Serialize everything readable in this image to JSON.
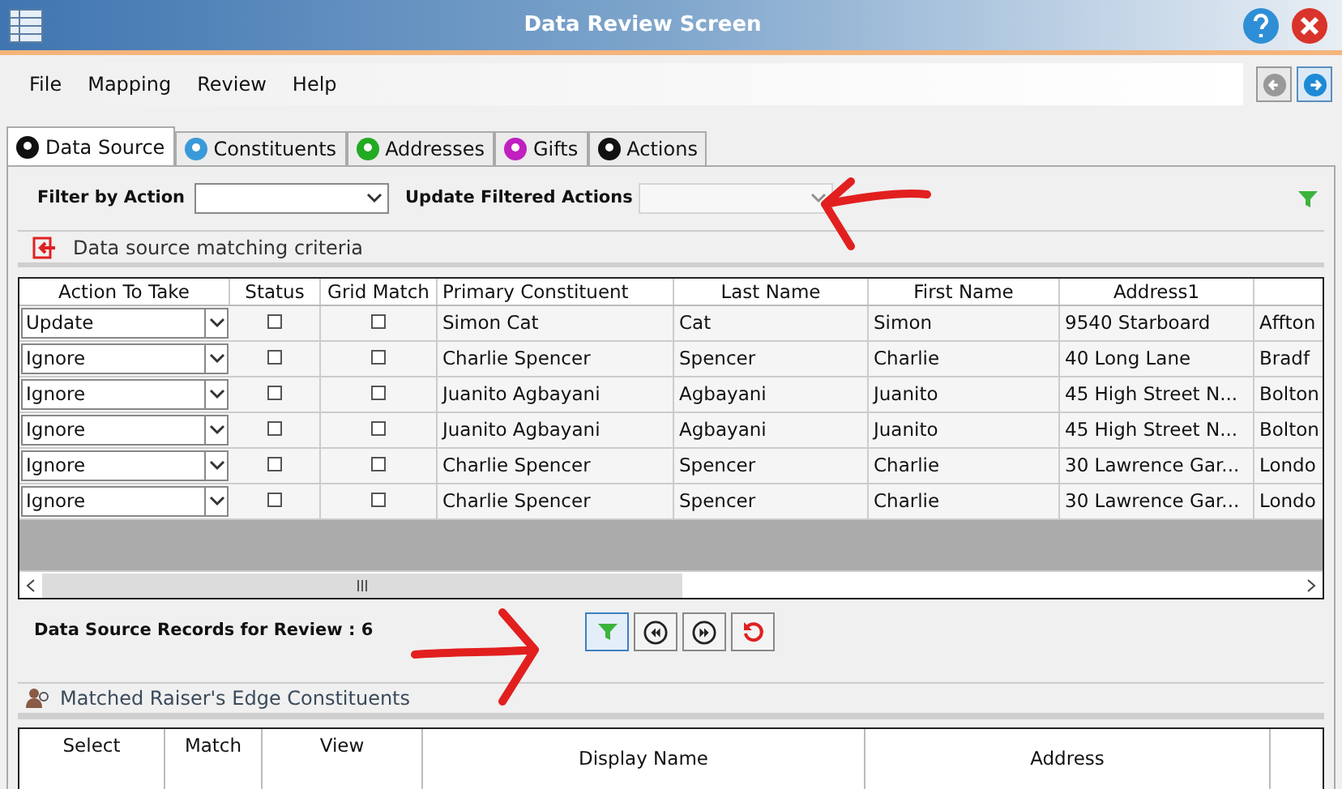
{
  "window": {
    "title": "Data Review Screen"
  },
  "menu": [
    "File",
    "Mapping",
    "Review",
    "Help"
  ],
  "tabs": [
    {
      "label": "Data Source",
      "selected": true,
      "color": "#111111"
    },
    {
      "label": "Constituents",
      "selected": false,
      "color": "#3a9ad9"
    },
    {
      "label": "Addresses",
      "selected": false,
      "color": "#22aa22"
    },
    {
      "label": "Gifts",
      "selected": false,
      "color": "#c020c0"
    },
    {
      "label": "Actions",
      "selected": false,
      "color": "#111111"
    }
  ],
  "filters": {
    "filter_label": "Filter by Action",
    "update_label": "Update Filtered Actions",
    "update_disabled": true
  },
  "criteria_label": "Data source matching criteria",
  "grid": {
    "columns": [
      "Action To Take",
      "Status",
      "Grid Match",
      "Primary Constituent",
      "Last Name",
      "First Name",
      "Address1"
    ],
    "rows": [
      {
        "cells": [
          {
            "kind": "dropdown",
            "text": "Update"
          },
          {
            "kind": "checkbox",
            "checked": false
          },
          {
            "kind": "checkbox",
            "checked": false
          },
          {
            "kind": "text",
            "text": "Simon Cat"
          },
          {
            "kind": "text",
            "text": "Cat"
          },
          {
            "kind": "text",
            "text": "Simon"
          },
          {
            "kind": "text",
            "text": "9540 Starboard"
          },
          {
            "kind": "text",
            "text": "Affton"
          }
        ]
      },
      {
        "cells": [
          {
            "kind": "dropdown",
            "text": "Ignore"
          },
          {
            "kind": "checkbox",
            "checked": false
          },
          {
            "kind": "checkbox",
            "checked": false
          },
          {
            "kind": "text",
            "text": "Charlie Spencer"
          },
          {
            "kind": "text",
            "text": "Spencer"
          },
          {
            "kind": "text",
            "text": "Charlie"
          },
          {
            "kind": "text",
            "text": "40 Long Lane"
          },
          {
            "kind": "text",
            "text": "Bradf"
          }
        ]
      },
      {
        "cells": [
          {
            "kind": "dropdown",
            "text": "Ignore"
          },
          {
            "kind": "checkbox",
            "checked": false
          },
          {
            "kind": "checkbox",
            "checked": false
          },
          {
            "kind": "text",
            "text": "Juanito Agbayani"
          },
          {
            "kind": "text",
            "text": "Agbayani"
          },
          {
            "kind": "text",
            "text": "Juanito"
          },
          {
            "kind": "text",
            "text": "45 High Street N..."
          },
          {
            "kind": "text",
            "text": "Bolton"
          }
        ]
      },
      {
        "cells": [
          {
            "kind": "dropdown",
            "text": "Ignore"
          },
          {
            "kind": "checkbox",
            "checked": false
          },
          {
            "kind": "checkbox",
            "checked": false
          },
          {
            "kind": "text",
            "text": "Juanito Agbayani"
          },
          {
            "kind": "text",
            "text": "Agbayani"
          },
          {
            "kind": "text",
            "text": "Juanito"
          },
          {
            "kind": "text",
            "text": "45 High Street N..."
          },
          {
            "kind": "text",
            "text": "Bolton"
          }
        ]
      },
      {
        "cells": [
          {
            "kind": "dropdown",
            "text": "Ignore"
          },
          {
            "kind": "checkbox",
            "checked": false
          },
          {
            "kind": "checkbox",
            "checked": false
          },
          {
            "kind": "text",
            "text": "Charlie Spencer"
          },
          {
            "kind": "text",
            "text": "Spencer"
          },
          {
            "kind": "text",
            "text": "Charlie"
          },
          {
            "kind": "text",
            "text": "30 Lawrence Gar..."
          },
          {
            "kind": "text",
            "text": "Londo"
          }
        ]
      },
      {
        "cells": [
          {
            "kind": "dropdown",
            "text": "Ignore"
          },
          {
            "kind": "checkbox",
            "checked": false
          },
          {
            "kind": "checkbox",
            "checked": false
          },
          {
            "kind": "text",
            "text": "Charlie Spencer"
          },
          {
            "kind": "text",
            "text": "Spencer"
          },
          {
            "kind": "text",
            "text": "Charlie"
          },
          {
            "kind": "text",
            "text": "30 Lawrence Gar..."
          },
          {
            "kind": "text",
            "text": "Londo"
          }
        ]
      }
    ]
  },
  "records_label": "Data Source Records for Review : 6",
  "matched_label": "Matched Raiser's Edge Constituents",
  "matched_grid": {
    "columns": [
      "Select",
      "Match",
      "View",
      "Display Name",
      "Address"
    ]
  }
}
